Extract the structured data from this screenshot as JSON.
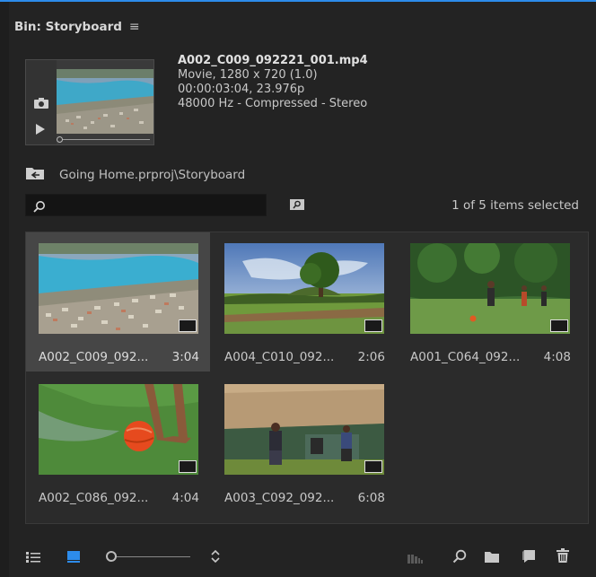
{
  "panel": {
    "title": "Bin: Storyboard",
    "menu_glyph": "≡"
  },
  "preview": {
    "filename": "A002_C009_092221_001.mp4",
    "line1": "Movie, 1280 x 720 (1.0)",
    "line2": "00:00:03:04, 23.976p",
    "line3": "48000 Hz - Compressed - Stereo"
  },
  "path": {
    "text": "Going Home.prproj\\Storyboard"
  },
  "search": {
    "value": "",
    "placeholder": ""
  },
  "selection": {
    "text": "1 of 5 items selected"
  },
  "clips": [
    {
      "name": "A002_C009_092...",
      "duration": "3:04",
      "selected": true
    },
    {
      "name": "A004_C010_092...",
      "duration": "2:06",
      "selected": false
    },
    {
      "name": "A001_C064_092...",
      "duration": "4:08",
      "selected": false
    },
    {
      "name": "A002_C086_092...",
      "duration": "4:04",
      "selected": false
    },
    {
      "name": "A003_C092_092...",
      "duration": "6:08",
      "selected": false
    }
  ],
  "colors": {
    "accent": "#2d8ceb",
    "panel_bg": "#232323",
    "grid_bg": "#2b2b2b",
    "selected_bg": "#464646"
  },
  "footer": {
    "icons": [
      "list-view-icon",
      "icon-view-icon",
      "zoom-slider",
      "sort-icon",
      "automate-sequence-icon",
      "find-icon",
      "new-bin-icon",
      "new-item-icon",
      "trash-icon"
    ]
  }
}
